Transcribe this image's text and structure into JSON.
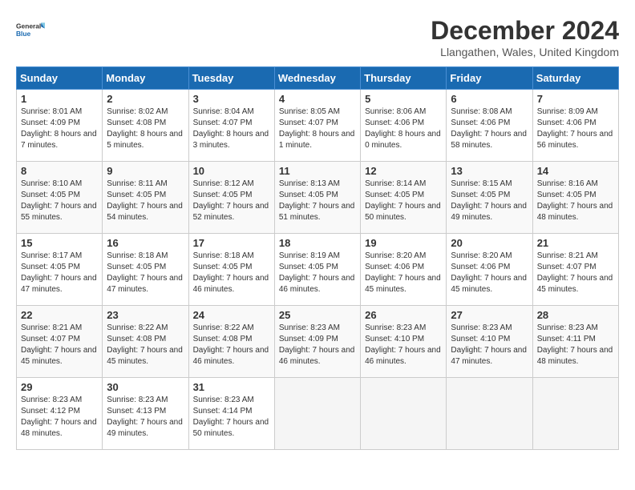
{
  "logo": {
    "line1": "General",
    "line2": "Blue"
  },
  "title": "December 2024",
  "location": "Llangathen, Wales, United Kingdom",
  "weekdays": [
    "Sunday",
    "Monday",
    "Tuesday",
    "Wednesday",
    "Thursday",
    "Friday",
    "Saturday"
  ],
  "weeks": [
    [
      {
        "day": "1",
        "sunrise": "8:01 AM",
        "sunset": "4:09 PM",
        "daylight": "8 hours and 7 minutes."
      },
      {
        "day": "2",
        "sunrise": "8:02 AM",
        "sunset": "4:08 PM",
        "daylight": "8 hours and 5 minutes."
      },
      {
        "day": "3",
        "sunrise": "8:04 AM",
        "sunset": "4:07 PM",
        "daylight": "8 hours and 3 minutes."
      },
      {
        "day": "4",
        "sunrise": "8:05 AM",
        "sunset": "4:07 PM",
        "daylight": "8 hours and 1 minute."
      },
      {
        "day": "5",
        "sunrise": "8:06 AM",
        "sunset": "4:06 PM",
        "daylight": "8 hours and 0 minutes."
      },
      {
        "day": "6",
        "sunrise": "8:08 AM",
        "sunset": "4:06 PM",
        "daylight": "7 hours and 58 minutes."
      },
      {
        "day": "7",
        "sunrise": "8:09 AM",
        "sunset": "4:06 PM",
        "daylight": "7 hours and 56 minutes."
      }
    ],
    [
      {
        "day": "8",
        "sunrise": "8:10 AM",
        "sunset": "4:05 PM",
        "daylight": "7 hours and 55 minutes."
      },
      {
        "day": "9",
        "sunrise": "8:11 AM",
        "sunset": "4:05 PM",
        "daylight": "7 hours and 54 minutes."
      },
      {
        "day": "10",
        "sunrise": "8:12 AM",
        "sunset": "4:05 PM",
        "daylight": "7 hours and 52 minutes."
      },
      {
        "day": "11",
        "sunrise": "8:13 AM",
        "sunset": "4:05 PM",
        "daylight": "7 hours and 51 minutes."
      },
      {
        "day": "12",
        "sunrise": "8:14 AM",
        "sunset": "4:05 PM",
        "daylight": "7 hours and 50 minutes."
      },
      {
        "day": "13",
        "sunrise": "8:15 AM",
        "sunset": "4:05 PM",
        "daylight": "7 hours and 49 minutes."
      },
      {
        "day": "14",
        "sunrise": "8:16 AM",
        "sunset": "4:05 PM",
        "daylight": "7 hours and 48 minutes."
      }
    ],
    [
      {
        "day": "15",
        "sunrise": "8:17 AM",
        "sunset": "4:05 PM",
        "daylight": "7 hours and 47 minutes."
      },
      {
        "day": "16",
        "sunrise": "8:18 AM",
        "sunset": "4:05 PM",
        "daylight": "7 hours and 47 minutes."
      },
      {
        "day": "17",
        "sunrise": "8:18 AM",
        "sunset": "4:05 PM",
        "daylight": "7 hours and 46 minutes."
      },
      {
        "day": "18",
        "sunrise": "8:19 AM",
        "sunset": "4:05 PM",
        "daylight": "7 hours and 46 minutes."
      },
      {
        "day": "19",
        "sunrise": "8:20 AM",
        "sunset": "4:06 PM",
        "daylight": "7 hours and 45 minutes."
      },
      {
        "day": "20",
        "sunrise": "8:20 AM",
        "sunset": "4:06 PM",
        "daylight": "7 hours and 45 minutes."
      },
      {
        "day": "21",
        "sunrise": "8:21 AM",
        "sunset": "4:07 PM",
        "daylight": "7 hours and 45 minutes."
      }
    ],
    [
      {
        "day": "22",
        "sunrise": "8:21 AM",
        "sunset": "4:07 PM",
        "daylight": "7 hours and 45 minutes."
      },
      {
        "day": "23",
        "sunrise": "8:22 AM",
        "sunset": "4:08 PM",
        "daylight": "7 hours and 45 minutes."
      },
      {
        "day": "24",
        "sunrise": "8:22 AM",
        "sunset": "4:08 PM",
        "daylight": "7 hours and 46 minutes."
      },
      {
        "day": "25",
        "sunrise": "8:23 AM",
        "sunset": "4:09 PM",
        "daylight": "7 hours and 46 minutes."
      },
      {
        "day": "26",
        "sunrise": "8:23 AM",
        "sunset": "4:10 PM",
        "daylight": "7 hours and 46 minutes."
      },
      {
        "day": "27",
        "sunrise": "8:23 AM",
        "sunset": "4:10 PM",
        "daylight": "7 hours and 47 minutes."
      },
      {
        "day": "28",
        "sunrise": "8:23 AM",
        "sunset": "4:11 PM",
        "daylight": "7 hours and 48 minutes."
      }
    ],
    [
      {
        "day": "29",
        "sunrise": "8:23 AM",
        "sunset": "4:12 PM",
        "daylight": "7 hours and 48 minutes."
      },
      {
        "day": "30",
        "sunrise": "8:23 AM",
        "sunset": "4:13 PM",
        "daylight": "7 hours and 49 minutes."
      },
      {
        "day": "31",
        "sunrise": "8:23 AM",
        "sunset": "4:14 PM",
        "daylight": "7 hours and 50 minutes."
      },
      null,
      null,
      null,
      null
    ]
  ],
  "labels": {
    "sunrise": "Sunrise:",
    "sunset": "Sunset:",
    "daylight": "Daylight:"
  }
}
